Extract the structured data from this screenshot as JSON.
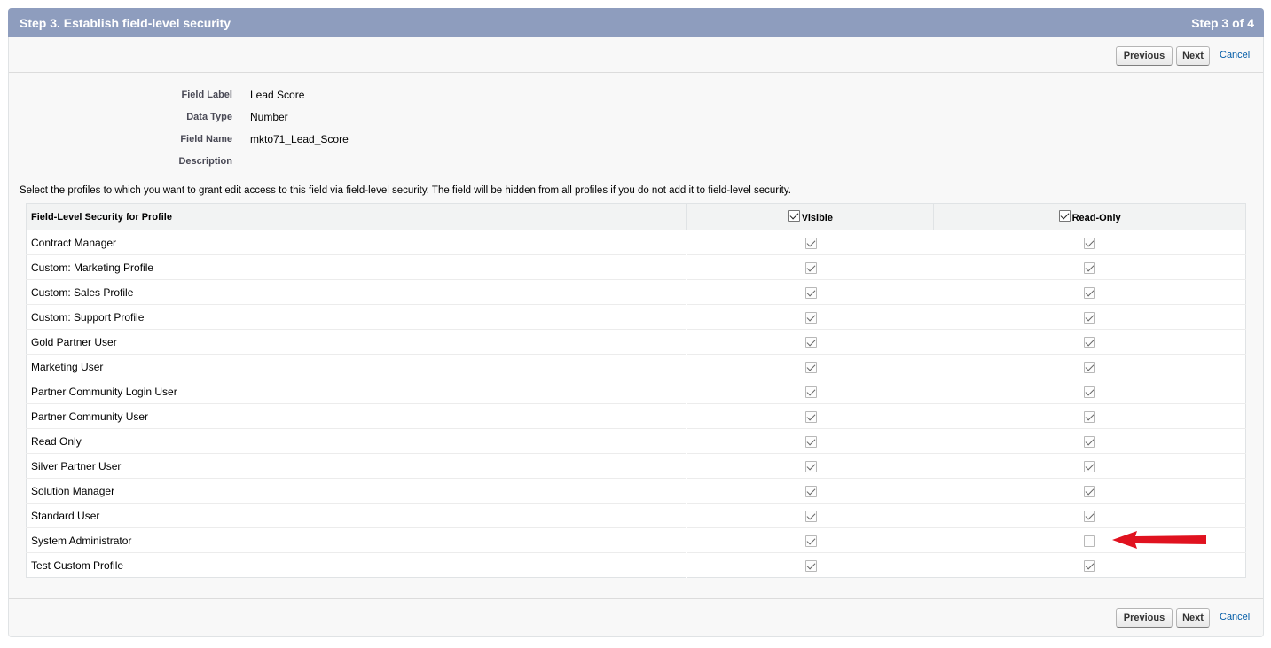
{
  "header": {
    "title": "Step 3. Establish field-level security",
    "step": "Step 3 of 4"
  },
  "buttons": {
    "previous": "Previous",
    "next": "Next",
    "cancel": "Cancel"
  },
  "field_info": [
    {
      "label": "Field Label",
      "value": "Lead Score"
    },
    {
      "label": "Data Type",
      "value": "Number"
    },
    {
      "label": "Field Name",
      "value": "mkto71_Lead_Score"
    },
    {
      "label": "Description",
      "value": ""
    }
  ],
  "instructions": "Select the profiles to which you want to grant edit access to this field via field-level security. The field will be hidden from all profiles if you do not add it to field-level security.",
  "table": {
    "columns": {
      "profile": "Field-Level Security for Profile",
      "visible": "Visible",
      "read_only": "Read-Only"
    },
    "header_checks": {
      "visible": true,
      "read_only": true
    },
    "rows": [
      {
        "profile": "Contract Manager",
        "visible": true,
        "read_only": true
      },
      {
        "profile": "Custom: Marketing Profile",
        "visible": true,
        "read_only": true
      },
      {
        "profile": "Custom: Sales Profile",
        "visible": true,
        "read_only": true
      },
      {
        "profile": "Custom: Support Profile",
        "visible": true,
        "read_only": true
      },
      {
        "profile": "Gold Partner User",
        "visible": true,
        "read_only": true
      },
      {
        "profile": "Marketing User",
        "visible": true,
        "read_only": true
      },
      {
        "profile": "Partner Community Login User",
        "visible": true,
        "read_only": true
      },
      {
        "profile": "Partner Community User",
        "visible": true,
        "read_only": true
      },
      {
        "profile": "Read Only",
        "visible": true,
        "read_only": true
      },
      {
        "profile": "Silver Partner User",
        "visible": true,
        "read_only": true
      },
      {
        "profile": "Solution Manager",
        "visible": true,
        "read_only": true
      },
      {
        "profile": "Standard User",
        "visible": true,
        "read_only": true
      },
      {
        "profile": "System Administrator",
        "visible": true,
        "read_only": false
      },
      {
        "profile": "Test Custom Profile",
        "visible": true,
        "read_only": true
      }
    ]
  },
  "annotation": {
    "icon": "red-arrow-icon",
    "color": "#e0121f"
  },
  "colors": {
    "header_bg": "#8e9dbe",
    "link": "#015ba7"
  }
}
